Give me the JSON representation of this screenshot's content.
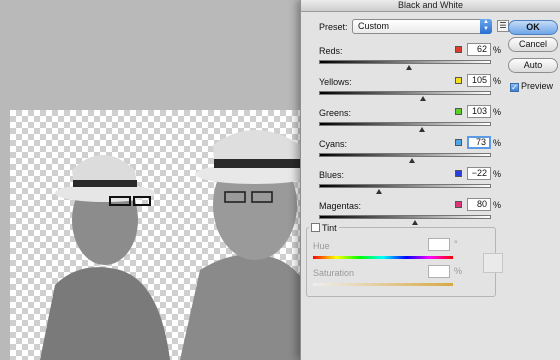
{
  "dialog": {
    "title": "Black and White",
    "preset_label": "Preset:",
    "preset_value": "Custom",
    "buttons": {
      "ok": "OK",
      "cancel": "Cancel",
      "auto": "Auto"
    },
    "preview_label": "Preview",
    "preview_checked": true,
    "sliders": [
      {
        "label": "Reds:",
        "value": "62",
        "unit": "%",
        "color": "#e03a2a"
      },
      {
        "label": "Yellows:",
        "value": "105",
        "unit": "%",
        "color": "#f2e21c"
      },
      {
        "label": "Greens:",
        "value": "103",
        "unit": "%",
        "color": "#5ad12a"
      },
      {
        "label": "Cyans:",
        "value": "73",
        "unit": "%",
        "color": "#4fa6e6"
      },
      {
        "label": "Blues:",
        "value": "−22",
        "unit": "%",
        "color": "#2a3fe0"
      },
      {
        "label": "Magentas:",
        "value": "80",
        "unit": "%",
        "color": "#e0347a"
      }
    ],
    "tint": {
      "label": "Tint",
      "checked": false,
      "hue_label": "Hue",
      "hue_unit": "°",
      "saturation_label": "Saturation",
      "saturation_unit": "%"
    }
  }
}
